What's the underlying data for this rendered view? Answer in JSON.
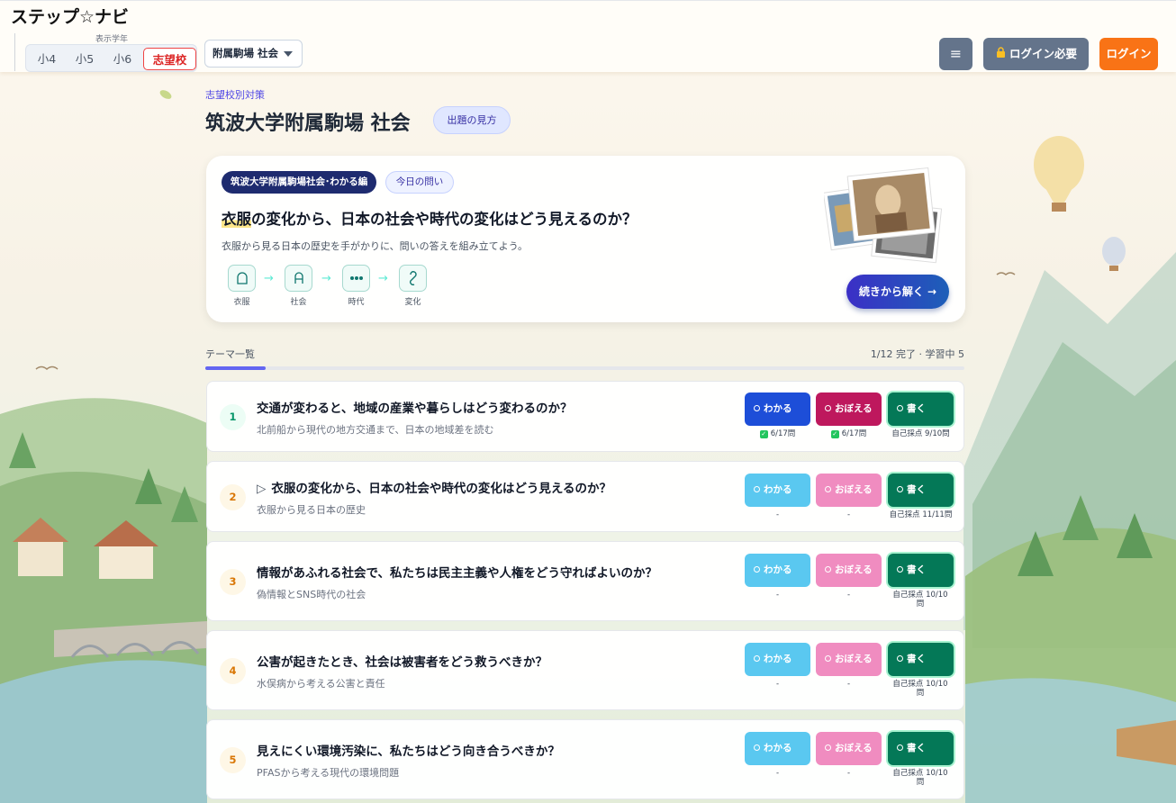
{
  "header": {
    "app_title": "ステップ☆ナビ",
    "grade_caption": "表示学年",
    "grades": [
      "小4",
      "小5",
      "小6",
      "志望校"
    ],
    "active_grade": "志望校",
    "school_select": "附属駒場 社会",
    "menu_icon": "≡",
    "login_required": "ログイン必要",
    "login": "ログイン"
  },
  "page": {
    "section_label": "志望校別対策",
    "title": "筑波大学附属駒場 社会",
    "howto": "出題の見方"
  },
  "hero": {
    "series_tag": "筑波大学附属駒場社会･わかる編",
    "today_tag": "今日の問い",
    "question_highlight": "衣服",
    "question_rest": "の変化から、日本の社会や時代の変化はどう見えるのか？",
    "subtitle": "衣服から見る日本の歴史を手がかりに、問いの答えを組み立てよう。",
    "flow": [
      {
        "label": "衣服",
        "icon": "clothes-icon"
      },
      {
        "label": "社会",
        "icon": "society-icon"
      },
      {
        "label": "時代",
        "icon": "era-icon"
      },
      {
        "label": "変化",
        "icon": "change-icon"
      }
    ],
    "flow_arrow": "→",
    "continue": "続きから解く →"
  },
  "list": {
    "caption": "テーマ一覧",
    "progress_text": "1/12 完了 · 学習中 5",
    "progress_fraction": 0.08
  },
  "labels": {
    "wakaru": "わかる",
    "oboeru": "おぼえる",
    "kaku": "書く"
  },
  "themes": [
    {
      "num": "1",
      "status": "done",
      "current": false,
      "title": "交通が変わると、地域の産業や暮らしはどう変わるのか？",
      "subtitle": "北前船から現代の地方交通まで、日本の地域差を読む",
      "wakaru_stat": "6/17問",
      "oboeru_stat": "6/17問",
      "kaku_stat": "自己採点 9/10問"
    },
    {
      "num": "2",
      "status": "todo",
      "current": true,
      "current_marker": "▷",
      "title": "衣服の変化から、日本の社会や時代の変化はどう見えるのか？",
      "subtitle": "衣服から見る日本の歴史",
      "wakaru_stat": "-",
      "oboeru_stat": "-",
      "kaku_stat": "自己採点 11/11問"
    },
    {
      "num": "3",
      "status": "todo",
      "current": false,
      "title": "情報があふれる社会で、私たちは民主主義や人権をどう守ればよいのか？",
      "subtitle": "偽情報とSNS時代の社会",
      "wakaru_stat": "-",
      "oboeru_stat": "-",
      "kaku_stat": "自己採点 10/10問"
    },
    {
      "num": "4",
      "status": "todo",
      "current": false,
      "title": "公害が起きたとき、社会は被害者をどう救うべきか？",
      "subtitle": "水俣病から考える公害と責任",
      "wakaru_stat": "-",
      "oboeru_stat": "-",
      "kaku_stat": "自己採点 10/10問"
    },
    {
      "num": "5",
      "status": "todo",
      "current": false,
      "title": "見えにくい環境汚染に、私たちはどう向き合うべきか？",
      "subtitle": "PFASから考える現代の環境問題",
      "wakaru_stat": "-",
      "oboeru_stat": "-",
      "kaku_stat": "自己採点 10/10問"
    }
  ]
}
